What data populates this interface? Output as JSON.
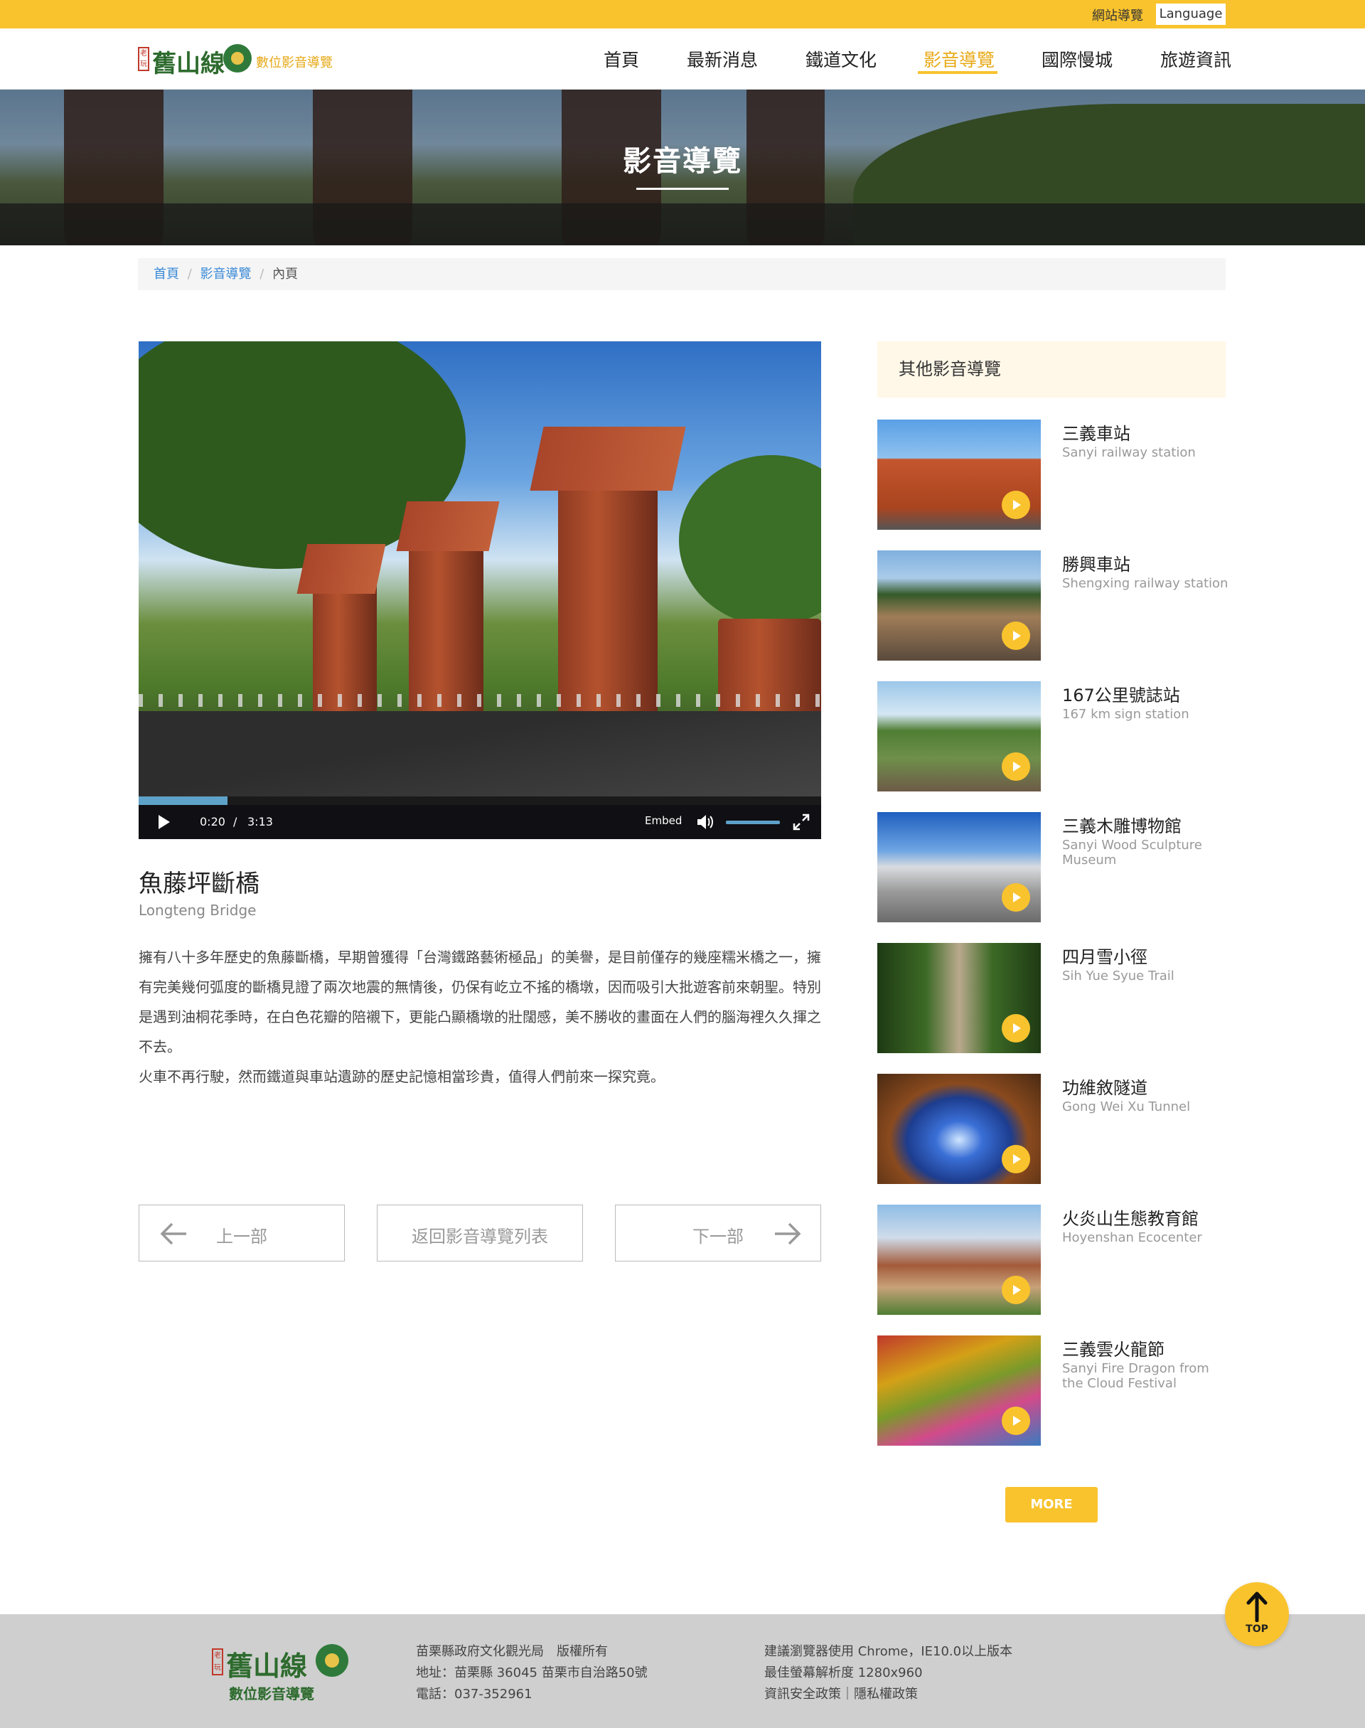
{
  "topbar": {
    "sitemap": "網站導覽",
    "language": "Language"
  },
  "logo": {
    "seal": "老玩",
    "name": "舊山線",
    "subtitle": "數位影音導覽"
  },
  "nav": [
    "首頁",
    "最新消息",
    "鐵道文化",
    "影音導覽",
    "國際慢城",
    "旅遊資訊"
  ],
  "banner": {
    "title": "影音導覽"
  },
  "breadcrumb": {
    "home": "首頁",
    "section": "影音導覽",
    "current": "內頁",
    "separator": "/"
  },
  "player": {
    "current_time": "0:20",
    "separator": "/",
    "duration": "3:13",
    "embed_label": "Embed",
    "progress": 0.13
  },
  "article": {
    "title": "魚藤坪斷橋",
    "subtitle": "Longteng Bridge",
    "paragraph1": "擁有八十多年歷史的魚藤斷橋，早期曾獲得「台灣鐵路藝術極品」的美譽，是目前僅存的幾座糯米橋之一，擁有完美幾何弧度的斷橋見證了兩次地震的無情後，仍保有屹立不搖的橋墩，因而吸引大批遊客前來朝聖。特別是遇到油桐花季時，在白色花瓣的陪襯下，更能凸顯橋墩的壯闊感，美不勝收的畫面在人們的腦海裡久久揮之不去。",
    "paragraph2": "火車不再行駛，然而鐵道與車站遺跡的歷史記憶相當珍貴，值得人們前來一探究竟。"
  },
  "pagination": {
    "prev": "上一部",
    "list": "返回影音導覽列表",
    "next": "下一部"
  },
  "sidebar": {
    "heading": "其他影音導覽",
    "items": [
      {
        "name": "三義車站",
        "en": "Sanyi railway station"
      },
      {
        "name": "勝興車站",
        "en": "Shengxing railway station"
      },
      {
        "name": "167公里號誌站",
        "en": "167 km sign station"
      },
      {
        "name": "三義木雕博物館",
        "en": "Sanyi Wood Sculpture Museum"
      },
      {
        "name": "四月雪小徑",
        "en": "Sih Yue Syue Trail"
      },
      {
        "name": "功維敘隧道",
        "en": "Gong Wei Xu Tunnel"
      },
      {
        "name": "火炎山生態教育館",
        "en": "Hoyenshan Ecocenter"
      },
      {
        "name": "三義雲火龍節",
        "en": "Sanyi Fire Dragon from the Cloud Festival"
      }
    ],
    "more": "MORE"
  },
  "footer": {
    "logo_name": "舊山線",
    "logo_seal": "老玩",
    "logo_subtitle": "數位影音導覽",
    "col1": [
      "苗栗縣政府文化觀光局　版權所有",
      "地址：苗栗縣 36045 苗栗市自治路50號",
      "電話：037-352961"
    ],
    "col2": [
      "建議瀏覽器使用 Chrome，IE10.0以上版本",
      "最佳螢幕解析度 1280x960",
      "資訊安全政策｜隱私權政策"
    ]
  },
  "top_button": "TOP",
  "colors": {
    "accent": "#f9c32e",
    "link": "#3a8ad8",
    "logo_green": "#2e6b2e"
  }
}
